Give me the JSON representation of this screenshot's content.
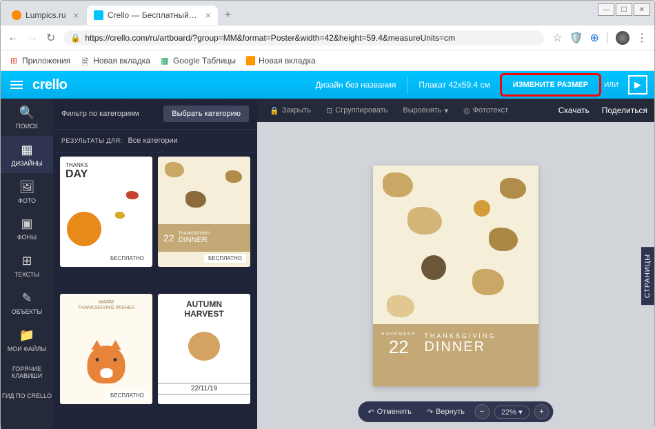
{
  "window": {
    "min": "—",
    "max": "☐",
    "close": "✕"
  },
  "tabs": [
    {
      "label": "Lumpics.ru",
      "active": false
    },
    {
      "label": "Crello — Бесплатный инструмен",
      "active": true
    }
  ],
  "nav": {
    "back": "←",
    "forward": "→",
    "reload": "↻"
  },
  "url": "https://crello.com/ru/artboard/?group=MM&format=Poster&width=42&height=59.4&measureUnits=cm",
  "bookmarks": {
    "apps": "Приложения",
    "items": [
      "Новая вкладка",
      "Google Таблицы",
      "Новая вкладка"
    ]
  },
  "header": {
    "logo": "crello",
    "title": "Дизайн без названия",
    "format": "Плакат 42x59.4 см",
    "resize": "ИЗМЕНИТЕ РАЗМЕР",
    "or": "ИЛИ"
  },
  "rail": [
    {
      "icon": "🔍",
      "label": "ПОИСК"
    },
    {
      "icon": "▦",
      "label": "ДИЗАЙНЫ"
    },
    {
      "icon": "🖼",
      "label": "ФОТО"
    },
    {
      "icon": "▣",
      "label": "ФОНЫ"
    },
    {
      "icon": "⊞",
      "label": "ТЕКСТЫ"
    },
    {
      "icon": "✎",
      "label": "ОБЪЕКТЫ"
    },
    {
      "icon": "📁",
      "label": "МОИ ФАЙЛЫ"
    },
    {
      "icon": "",
      "label": "ГОРЯЧИЕ КЛАВИШИ"
    },
    {
      "icon": "",
      "label": "ГИД ПО CRELLO"
    }
  ],
  "panel": {
    "filter_label": "Фильтр по категориям",
    "choose_btn": "Выбрать категорию",
    "results_label": "РЕЗУЛЬТАТЫ ДЛЯ:",
    "results_value": "Все категории",
    "templates": [
      {
        "title1": "THANKS",
        "title2": "DAY",
        "badge": "БЕСПЛАТНО",
        "scheme": "pumpkin"
      },
      {
        "title1": "22",
        "title2": "DINNER",
        "sub": "THANKSGIVING",
        "badge": "БЕСПЛАТНО",
        "scheme": "leaves"
      },
      {
        "title1": "WARM",
        "title2": "THANKSGIVING WISHES",
        "badge": "БЕСПЛАТНО",
        "scheme": "fox"
      },
      {
        "title1": "AUTUMN",
        "title2": "HARVEST",
        "date": "22/11/19",
        "badge": "",
        "scheme": "harvest"
      }
    ]
  },
  "canvasToolbar": {
    "close": "Закрыть",
    "group": "Сгруппировать",
    "align": "Выровнять",
    "phototext": "Фототекст",
    "download": "Скачать",
    "share": "Поделиться"
  },
  "poster": {
    "month": "NOVEMBER",
    "day": "22",
    "title1": "THANKSGIVING",
    "title2": "DINNER"
  },
  "bottomControls": {
    "undo": "Отменить",
    "redo": "Вернуть",
    "zoom": "22%"
  },
  "pagesTab": "СТРАНИЦЫ"
}
